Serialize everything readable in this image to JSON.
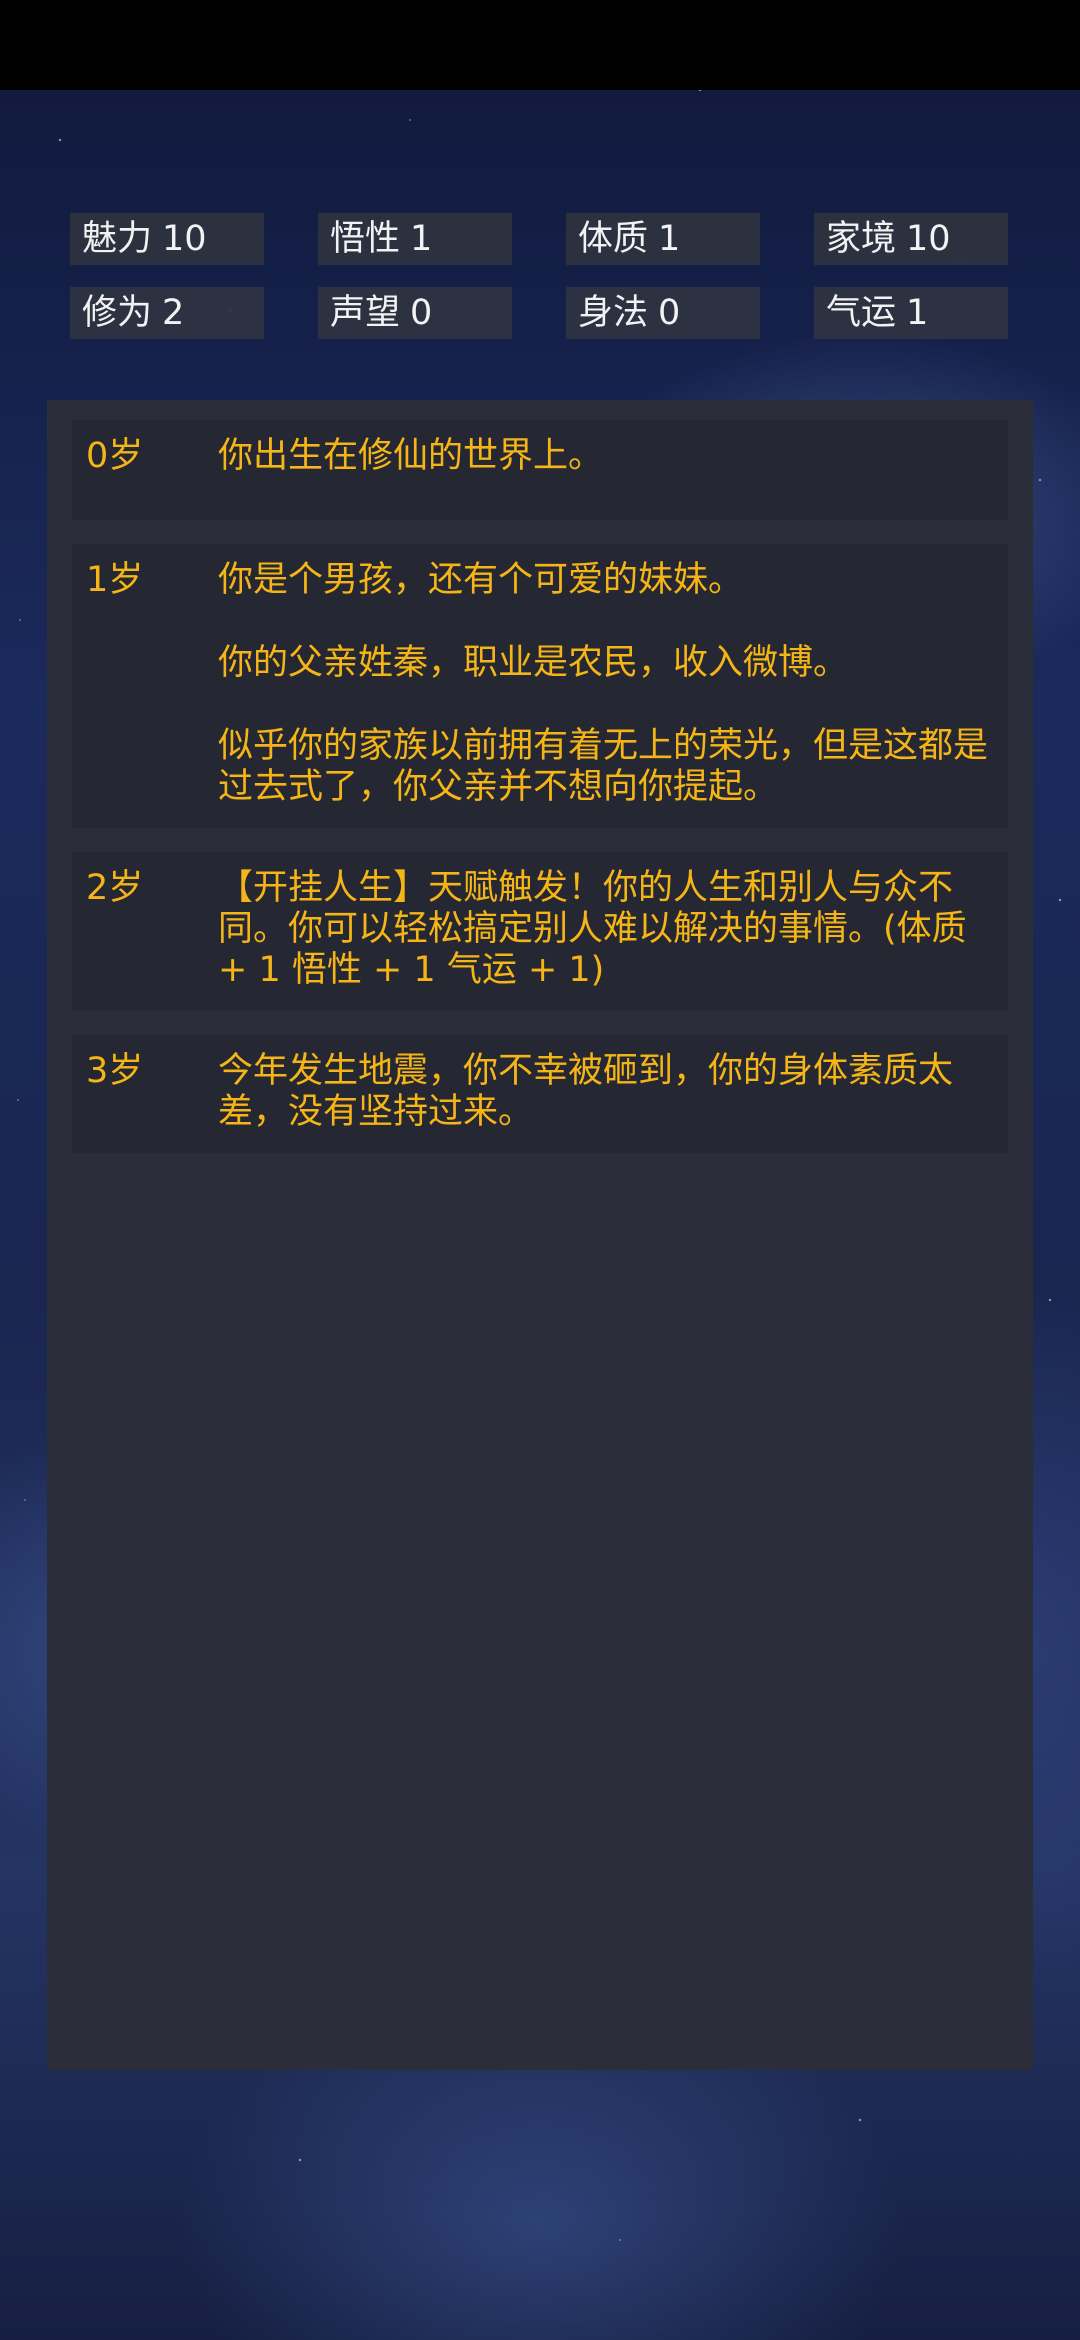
{
  "stats": [
    {
      "label": "魅力",
      "value": "10"
    },
    {
      "label": "悟性",
      "value": "1"
    },
    {
      "label": "体质",
      "value": "1"
    },
    {
      "label": "家境",
      "value": "10"
    },
    {
      "label": "修为",
      "value": "2"
    },
    {
      "label": "声望",
      "value": "0"
    },
    {
      "label": "身法",
      "value": "0"
    },
    {
      "label": "气运",
      "value": "1"
    }
  ],
  "log": [
    {
      "age": "0岁",
      "texts": [
        "你出生在修仙的世界上。"
      ]
    },
    {
      "age": "1岁",
      "texts": [
        "你是个男孩，还有个可爱的妹妹。",
        "你的父亲姓秦，职业是农民，收入微博。",
        "似乎你的家族以前拥有着无上的荣光，但是这都是过去式了，你父亲并不想向你提起。"
      ]
    },
    {
      "age": "2岁",
      "texts": [
        "【开挂人生】天赋触发！你的人生和别人与众不同。你可以轻松搞定别人难以解决的事情。(体质 + 1 悟性 + 1 气运 + 1)"
      ]
    },
    {
      "age": "3岁",
      "texts": [
        "今年发生地震，你不幸被砸到，你的身体素质太差，没有坚持过来。"
      ]
    }
  ]
}
